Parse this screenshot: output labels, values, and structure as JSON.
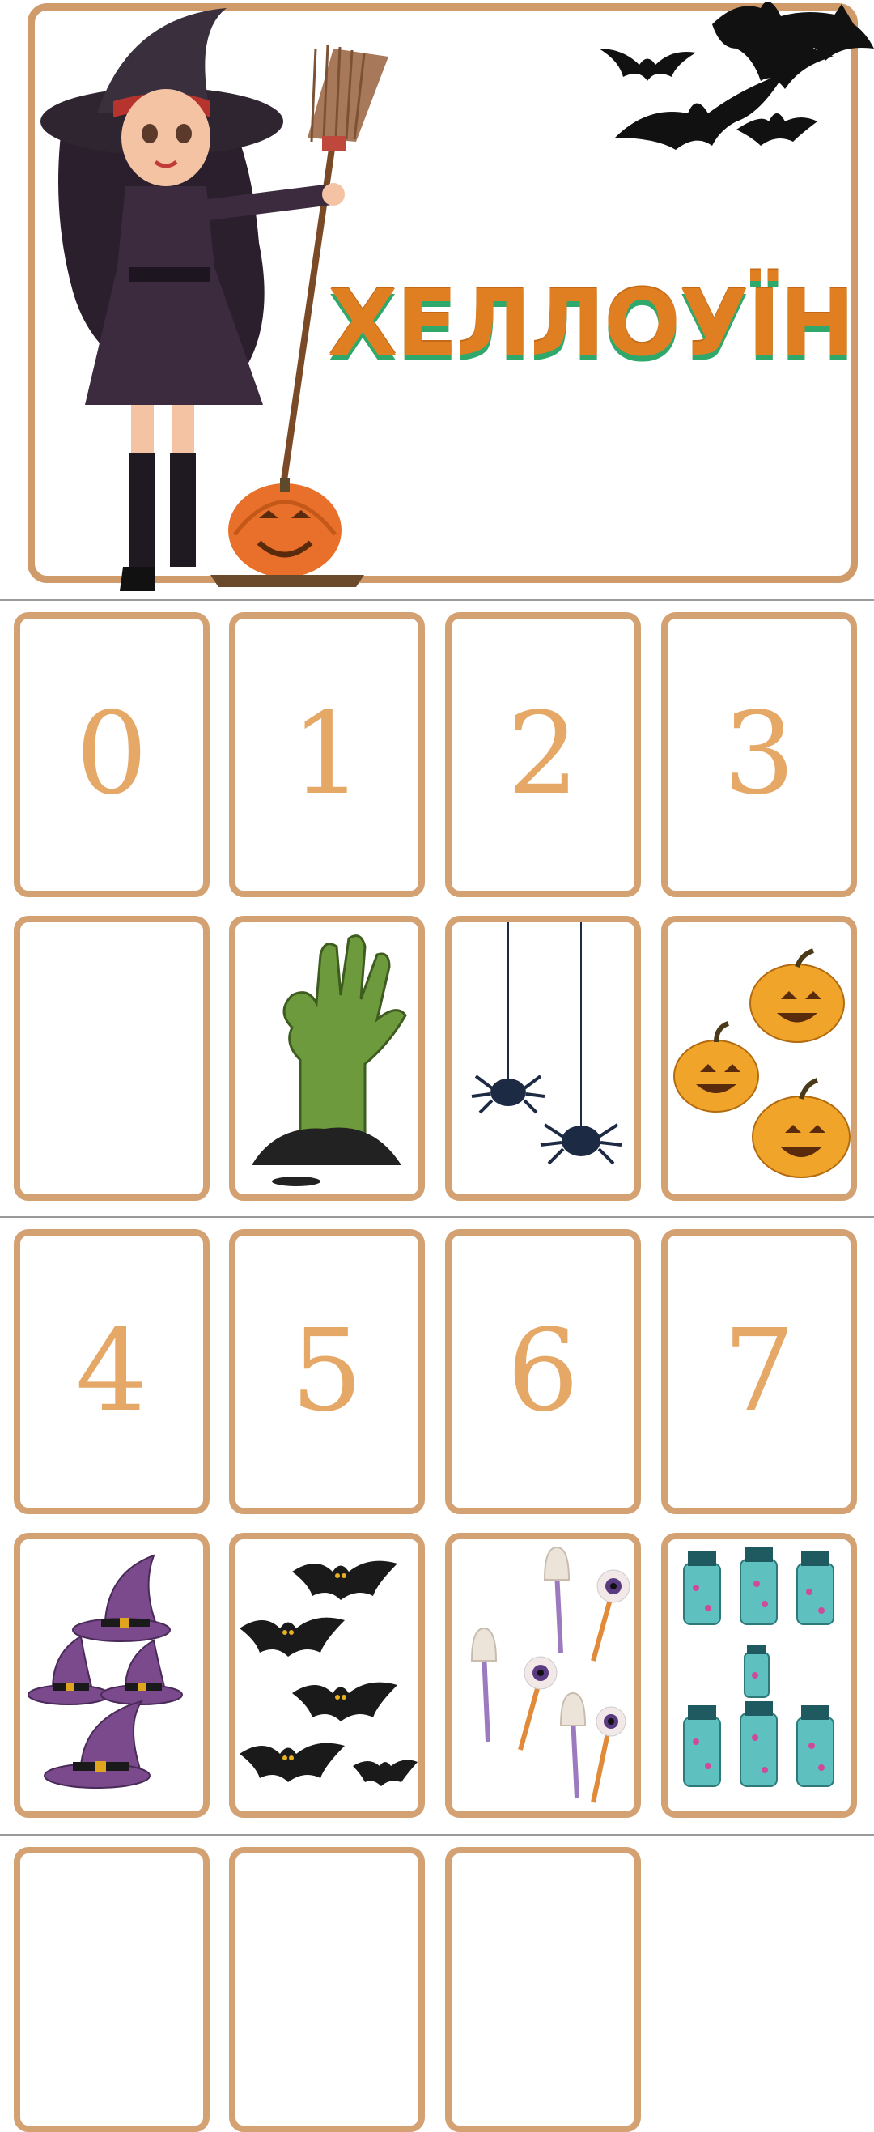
{
  "cover": {
    "title": "ХЕЛЛОУЇН"
  },
  "pages": [
    {
      "numbers": [
        "0",
        "1",
        "2",
        "3"
      ],
      "pictures": [
        "empty-card",
        "zombie-hand",
        "two-spiders",
        "three-pumpkins"
      ]
    },
    {
      "numbers": [
        "4",
        "5",
        "6",
        "7"
      ],
      "pictures": [
        "four-witch-hats",
        "five-bats",
        "six-eyeball-lollipops",
        "seven-potion-jars"
      ]
    }
  ],
  "colors": {
    "frame": "#cf9b6b",
    "number": "#e6a867",
    "title": "#e07f22",
    "title_shadow": "#2fa86c"
  }
}
